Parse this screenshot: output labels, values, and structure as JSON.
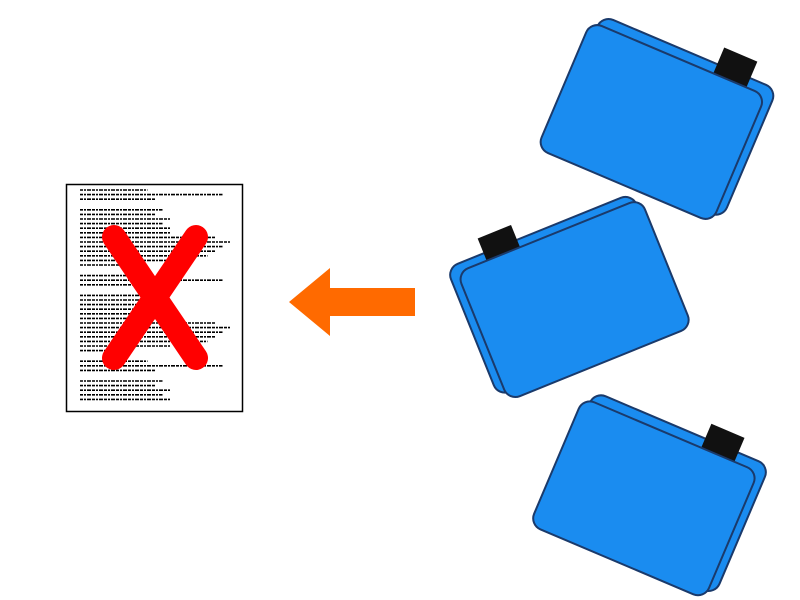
{
  "diagram": {
    "document": {
      "icon": "text-document-icon",
      "mark_icon": "red-x-mark-icon",
      "paper_color": "#ffffff",
      "border_color": "#000000",
      "text_color": "#000000",
      "mark_color": "#ff0000"
    },
    "arrow": {
      "icon": "left-arrow-icon",
      "direction": "left",
      "color": "#ff6a00"
    },
    "folders": [
      {
        "icon": "folder-icon",
        "color": "#1a8cf0",
        "tab_color": "#111111",
        "outline_color": "#1a3a6b"
      },
      {
        "icon": "folder-icon",
        "color": "#1a8cf0",
        "tab_color": "#111111",
        "outline_color": "#1a3a6b"
      },
      {
        "icon": "folder-icon",
        "color": "#1a8cf0",
        "tab_color": "#111111",
        "outline_color": "#1a3a6b"
      }
    ]
  }
}
